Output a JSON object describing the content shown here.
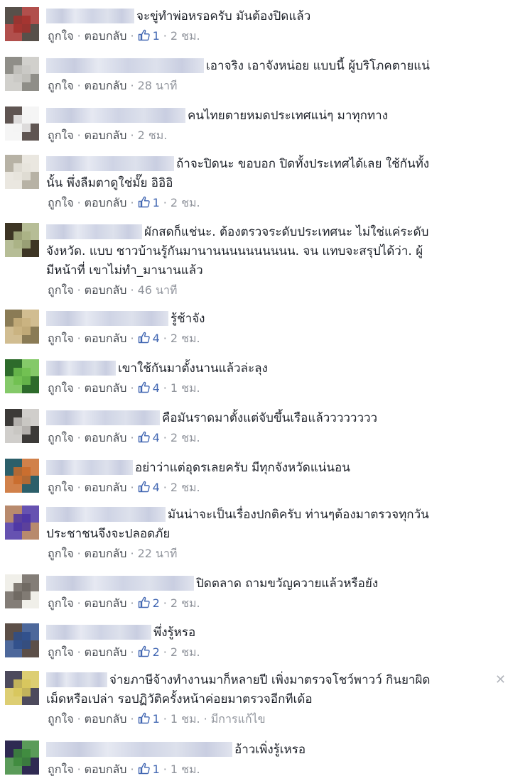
{
  "ui": {
    "like": "ถูกใจ",
    "reply": "ตอบกลับ",
    "close": "✕"
  },
  "comments": [
    {
      "lines": [
        "จะขู่ทำพ่อหรอครับ มันต้องปิดแล้ว"
      ],
      "likes": "1",
      "time": "2 ชม.",
      "avatar": [
        "#57504a",
        "#a3302d"
      ]
    },
    {
      "lines": [
        "เอาจริง เอาจังหน่อย แบบนี้ ผู้บริโภคตายแน่"
      ],
      "time": "28 นาที",
      "avatar": [
        "#8f8e88",
        "#c9c8c3"
      ]
    },
    {
      "lines": [
        "คนไทยตายหมดประเทศแน่ๆ มาทุกทาง"
      ],
      "time": "2 ชม.",
      "avatar": [
        "#5f5552",
        "#f3f3f3"
      ]
    },
    {
      "lines": [
        "ถ้าจะปิดนะ ขอบอก ปิดทั้งประเทศได้เลย ใช้กันทั้ง",
        "นั้น พึ่งลืมตาดูใช่มั๊ย อิอิอิ"
      ],
      "likes": "1",
      "time": "2 ชม.",
      "avatar": [
        "#b7b2a5",
        "#e6e3da"
      ]
    },
    {
      "lines": [
        "ผักสดก็แช่นะ. ต้องตรวจระดับประเทศนะ ไม่ใช่แค่ระดับ",
        "จังหวัด. แบบ ชาวบ้านรู้กันมานานนนนนนนนนน. จน แทบจะสรุปได้ว่า. ผู้",
        "มีหน้าที่ เขาไม่ทำ_มานานแล้ว"
      ],
      "time": "46 นาที",
      "avatar": [
        "#3d3524",
        "#a9b184"
      ]
    },
    {
      "lines": [
        "รู้ช้าจัง"
      ],
      "likes": "4",
      "time": "2 ชม.",
      "avatar": [
        "#8a7b55",
        "#c9b27e"
      ]
    },
    {
      "lines": [
        "เขาใช้กันมาตั้งนานแล้วล่ะลุง"
      ],
      "likes": "4",
      "time": "1 ชม.",
      "avatar": [
        "#2d6b2b",
        "#6fbf4f"
      ]
    },
    {
      "lines": [
        "คือมันราดมาตั้งแต่จับขึ้นเรือแล้วววววววว"
      ],
      "likes": "4",
      "time": "2 ชม.",
      "avatar": [
        "#3c3a38",
        "#c8c6c2"
      ]
    },
    {
      "lines": [
        "อย่าว่าแต่อุดรเลยครับ มีทุกจังหวัดแน่นอน"
      ],
      "likes": "4",
      "time": "2 ชม.",
      "avatar": [
        "#2c5f6a",
        "#c96b2a"
      ]
    },
    {
      "lines": [
        "มันน่าจะเป็นเรื่องปกติครับ ท่านๆต้องมาตรวจทุกวัน",
        "ประชาชนจึงจะปลอดภัย"
      ],
      "time": "22 นาที",
      "avatar": [
        "#b88a6d",
        "#4b34a3"
      ]
    },
    {
      "lines": [
        "ปิดตลาด ถามขวัญควายแล้วหรือยัง"
      ],
      "likes": "2",
      "time": "2 ชม.",
      "avatar": [
        "#f0efe9",
        "#6d665f"
      ]
    },
    {
      "lines": [
        "พึ่งรู้หรอ"
      ],
      "likes": "2",
      "time": "2 ชม.",
      "avatar": [
        "#5c4f48",
        "#2e4e8a"
      ]
    },
    {
      "lines": [
        "จ่ายภาษีจ้างทำงานมาก็หลายปี เพิ่งมาตรวจโชว์พาวว์ กินยาผิด",
        "เม็ดหรือเปล่า รอปฏิวัติครั้งหน้าค่อยมาตรวจอีกทีเด้อ"
      ],
      "likes": "1",
      "time": "1 ชม.",
      "edited": "มีการแก้ไข",
      "avatar": [
        "#4d4a5c",
        "#d7c65a"
      ]
    },
    {
      "lines": [
        "อ้าวเพิ่งรู้เหรอ"
      ],
      "likes": "1",
      "time": "1 ชม.",
      "avatar": [
        "#2f2a52",
        "#3d8a3c"
      ]
    }
  ]
}
